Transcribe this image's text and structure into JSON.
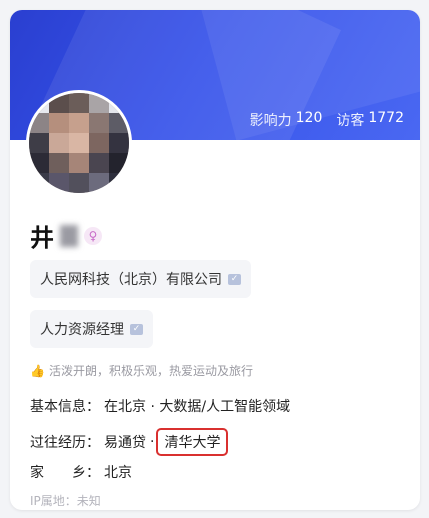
{
  "header": {
    "stats": [
      {
        "label": "影响力",
        "value": "120"
      },
      {
        "label": "访客",
        "value": "1772"
      }
    ]
  },
  "profile": {
    "name_visible": "井",
    "gender_icon": "female-icon",
    "company": "人民网科技（北京）有限公司",
    "position": "人力资源经理",
    "motto": "活泼开朗，积极乐观，热爱运动及旅行",
    "basic_info_label": "基本信息：",
    "basic_info_value": "在北京 · 大数据/人工智能领域",
    "past_exp_label": "过往经历：",
    "past_exp_company": "易通贷",
    "past_exp_sep": "·",
    "past_exp_school": "清华大学",
    "hometown_label": "家　　乡：",
    "hometown_value": "北京",
    "ip_location": "IP属地：未知"
  },
  "colors": {
    "banner": "#3652ea",
    "highlight_border": "#d9302f"
  }
}
